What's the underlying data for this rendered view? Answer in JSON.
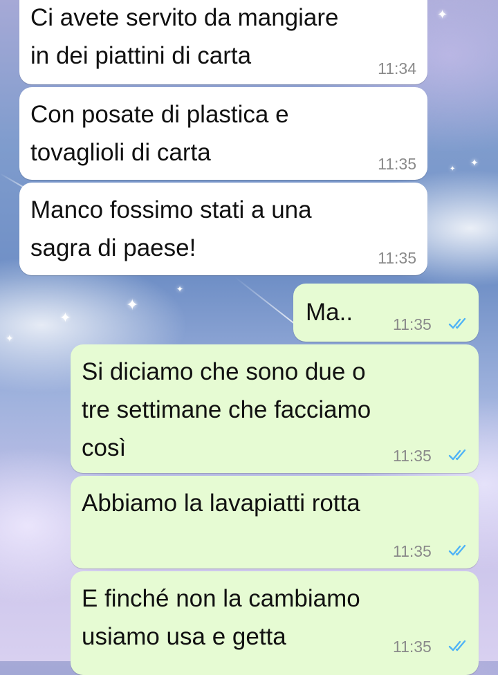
{
  "chat": {
    "messages": [
      {
        "direction": "incoming",
        "text": "Ci avete servito da mangiare\nin dei piattini di carta",
        "time": "11:34"
      },
      {
        "direction": "incoming",
        "text": "Con posate di plastica e\ntovaglioli di carta",
        "time": "11:35"
      },
      {
        "direction": "incoming",
        "text": "Manco fossimo stati a una\nsagra di paese!",
        "time": "11:35"
      },
      {
        "direction": "outgoing",
        "text": "Ma..",
        "time": "11:35",
        "status": "read"
      },
      {
        "direction": "outgoing",
        "text": "Si diciamo che sono due o\ntre settimane che facciamo\ncosì",
        "time": "11:35",
        "status": "read"
      },
      {
        "direction": "outgoing",
        "text": "Abbiamo la lavapiatti rotta",
        "time": "11:35",
        "status": "read"
      },
      {
        "direction": "outgoing",
        "text": "E finché non la cambiamo\nusiamo usa e getta",
        "time": "11:35",
        "status": "read"
      }
    ]
  },
  "colors": {
    "incoming_bubble": "#ffffff",
    "outgoing_bubble": "#e6fbd3",
    "read_ticks": "#4fb3f6",
    "timestamp": "#8a8a8a"
  },
  "icons": {
    "read_receipt": "double-check-icon"
  }
}
